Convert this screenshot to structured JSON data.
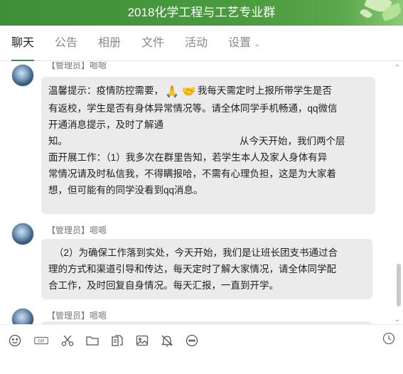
{
  "window": {
    "title": "2018化学工程与工艺专业群"
  },
  "tabs": [
    {
      "label": "聊天"
    },
    {
      "label": "公告"
    },
    {
      "label": "相册"
    },
    {
      "label": "文件"
    },
    {
      "label": "活动"
    },
    {
      "label": "设置"
    }
  ],
  "messages": [
    {
      "sender": "【管理员】嗯嗯",
      "lines": [
        "温馨提示：疫情防控需要，",
        "我每天需定时上报所带学生是否",
        "有返校，学生是否有身体异常情况等。请全体同学手机畅通，qq微信",
        "开通消息提示，及时了解通",
        "知。",
        "从今天开始，我们两个层",
        "面开展工作：（1）我多次在群里告知，若学生本人及家人身体有异",
        "常情况请及时私信我，不得瞒报哈，不需有心理负担，这是为大家着",
        "想，但可能有的同学没看到qq消息。"
      ]
    },
    {
      "sender": "【管理员】嗯嗯",
      "lines": [
        "（2）为确保工作落到实处，今天开始，我们是让班长团支书通过合",
        "理的方式和渠道引导和传达，每天定时了解大家情况，请全体同学配",
        "合工作，及时回复自身情况。每天汇报，一直到开学。"
      ]
    },
    {
      "sender": "【管理员】嗯嗯"
    }
  ],
  "toolbar": {
    "icons": [
      "emoji-icon",
      "gif-icon",
      "scissors-icon",
      "folder-icon",
      "image-stack-icon",
      "picture-icon",
      "bell-icon",
      "more-icon"
    ],
    "gif_label": "GIF"
  }
}
